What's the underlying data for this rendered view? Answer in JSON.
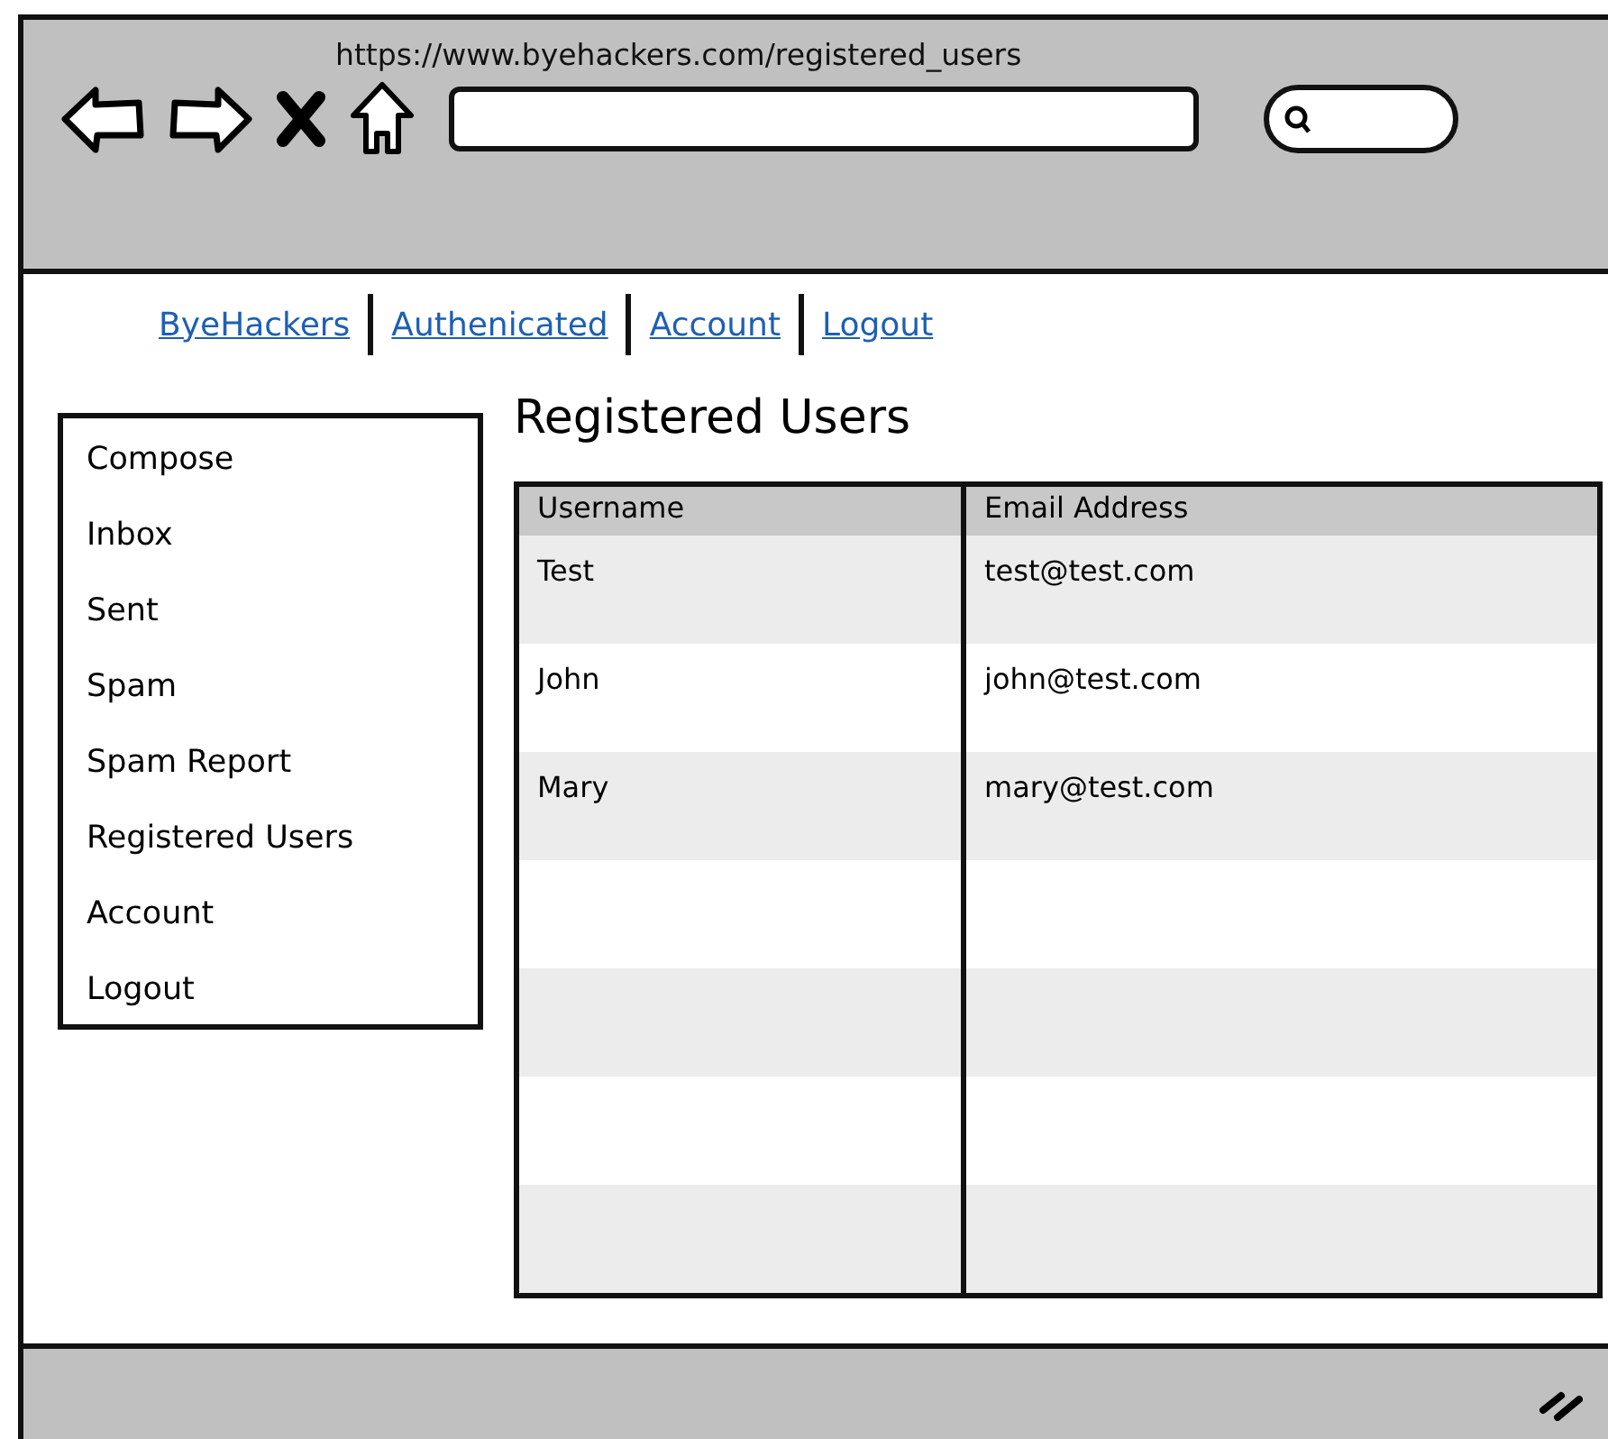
{
  "browser": {
    "url": "https://www.byehackers.com/registered_users"
  },
  "nav_links": [
    "ByeHackers",
    "Authenicated",
    "Account",
    "Logout"
  ],
  "sidebar": {
    "items": [
      "Compose",
      "Inbox",
      "Sent",
      "Spam",
      "Spam Report",
      "Registered Users",
      "Account",
      "Logout"
    ]
  },
  "page_title": "Registered Users",
  "table": {
    "columns": [
      "Username",
      "Email Address"
    ],
    "rows": [
      [
        "Test",
        "test@test.com"
      ],
      [
        "John",
        "john@test.com"
      ],
      [
        "Mary",
        "mary@test.com"
      ]
    ]
  }
}
